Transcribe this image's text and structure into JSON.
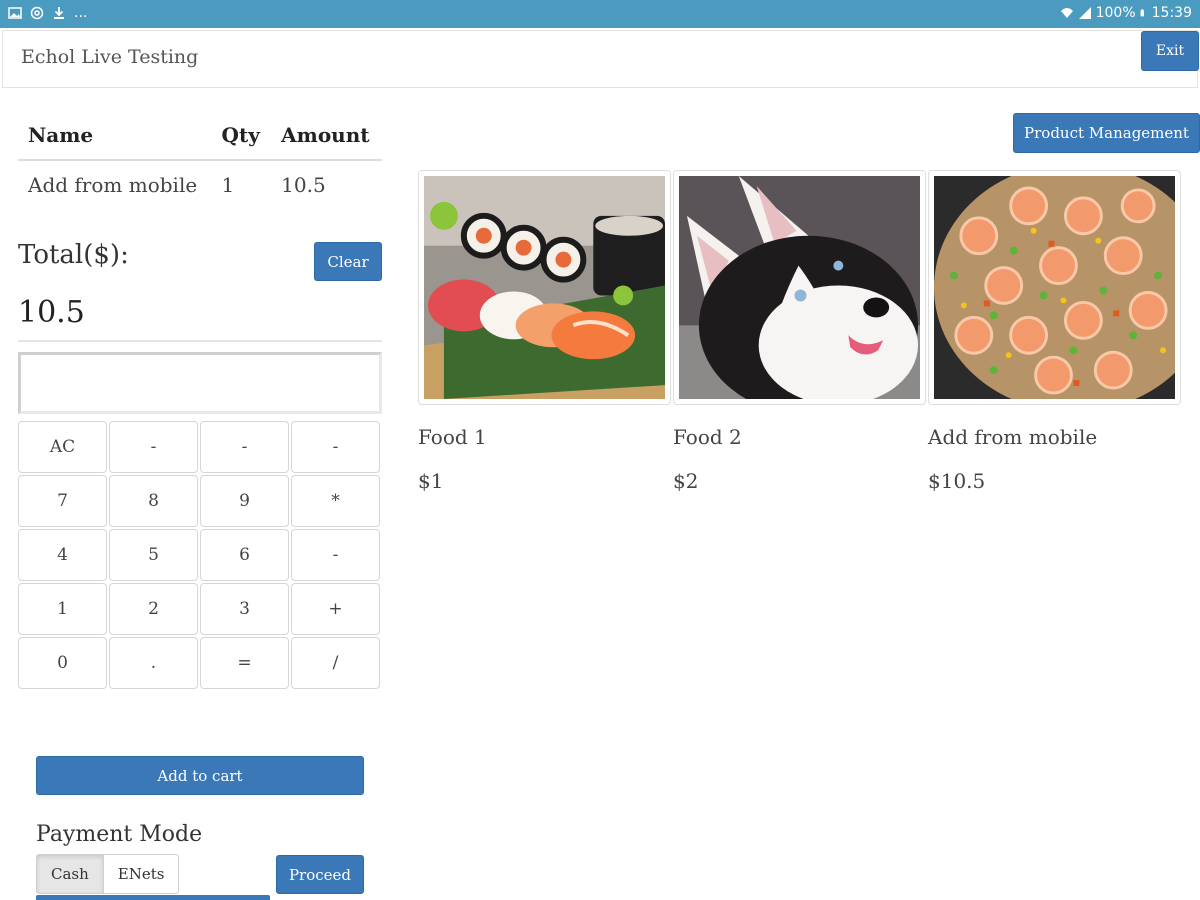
{
  "status_bar": {
    "left_icons": [
      "image-icon",
      "at-icon",
      "download-icon"
    ],
    "ellipsis": "...",
    "battery": "100%",
    "time": "15:39"
  },
  "header": {
    "title": "Echol Live Testing",
    "exit_label": "Exit"
  },
  "cart": {
    "columns": [
      "Name",
      "Qty",
      "Amount"
    ],
    "rows": [
      {
        "name": "Add from mobile",
        "qty": "1",
        "amount": "10.5"
      }
    ],
    "total_label": "Total($):",
    "total_value": "10.5",
    "clear_label": "Clear",
    "display_value": ""
  },
  "keypad": {
    "keys": [
      "AC",
      "-",
      "-",
      "-",
      "7",
      "8",
      "9",
      "*",
      "4",
      "5",
      "6",
      "-",
      "1",
      "2",
      "3",
      "+",
      "0",
      ".",
      "=",
      "/"
    ]
  },
  "add_to_cart_label": "Add to cart",
  "payment": {
    "label": "Payment Mode",
    "options": [
      "Cash",
      "ENets"
    ],
    "selected": "Cash",
    "proceed_label": "Proceed"
  },
  "products_panel": {
    "management_label": "Product Management",
    "items": [
      {
        "name": "Food 1",
        "price": "$1",
        "image": "sushi-image"
      },
      {
        "name": "Food 2",
        "price": "$2",
        "image": "husky-dog-image"
      },
      {
        "name": "Add from mobile",
        "price": "$10.5",
        "image": "shrimp-fried-rice-image"
      }
    ]
  },
  "colors": {
    "status_bar": "#4a9bbf",
    "primary_button": "#3a78b8"
  }
}
